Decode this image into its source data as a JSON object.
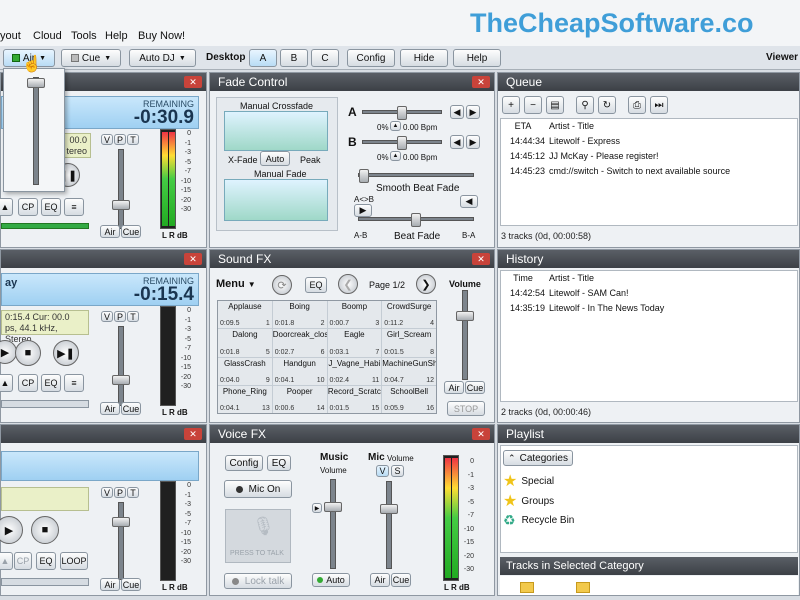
{
  "menubar": {
    "items": [
      "yout",
      "Cloud",
      "Tools",
      "Help",
      "Buy Now!"
    ],
    "watermark": "TheCheapSoftware.co"
  },
  "toolbar": {
    "air": "Air",
    "cue": "Cue",
    "auto_dj": "Auto DJ",
    "desktop_label": "Desktop",
    "desk_a": "A",
    "desk_b": "B",
    "desk_c": "C",
    "config": "Config",
    "hide": "Hide",
    "help": "Help",
    "viewer": "Viewer"
  },
  "decks": [
    {
      "remaining_label": "REMAINING",
      "remaining": "-0:30.9",
      "info_line1": "00.0",
      "info_line2": "tereo",
      "cp": "CP",
      "eq": "EQ"
    },
    {
      "title": "ay",
      "remaining_label": "REMAINING",
      "remaining": "-0:15.4",
      "info_line1": "0:15.4      Cur: 00.0",
      "info_line2": "ps, 44.1 kHz, Stereo",
      "cp": "CP",
      "eq": "EQ"
    },
    {
      "cp": "CP",
      "eq": "EQ",
      "loop": "LOOP"
    }
  ],
  "channel": {
    "v": "V",
    "p": "P",
    "t": "T",
    "air": "Air",
    "cue": "Cue",
    "lr": "L R",
    "db": "dB"
  },
  "meter_scale": [
    "0",
    "-1",
    "-3",
    "-5",
    "-7",
    "-10",
    "-15",
    "-20",
    "-30"
  ],
  "fade_control": {
    "title": "Fade Control",
    "manual_crossfade": "Manual Crossfade",
    "xfade": "X-Fade",
    "auto": "Auto",
    "peak": "Peak",
    "manual_fade": "Manual Fade",
    "a": "A",
    "b": "B",
    "pct_a": "0%",
    "bpm_a": "0.00 Bpm",
    "pct_b": "0%",
    "bpm_b": "0.00 Bpm",
    "smooth_beat_fade": "Smooth Beat Fade",
    "a_to_b": "A<>B",
    "a_b": "A-B",
    "beat_fade": "Beat Fade",
    "b_a": "B-A"
  },
  "sound_fx": {
    "title": "Sound FX",
    "menu": "Menu",
    "eq": "EQ",
    "page": "Page 1/2",
    "volume": "Volume",
    "air": "Air",
    "cue": "Cue",
    "stop": "STOP",
    "cells": [
      {
        "name": "Applause",
        "time": "0:09.5",
        "num": "1"
      },
      {
        "name": "Boing",
        "time": "0:01.8",
        "num": "2"
      },
      {
        "name": "Boomp",
        "time": "0:00.7",
        "num": "3"
      },
      {
        "name": "CrowdSurge",
        "time": "0:11.2",
        "num": "4"
      },
      {
        "name": "Dalong",
        "time": "0:01.8",
        "num": "5"
      },
      {
        "name": "Doorcreak_closi",
        "time": "0:02.7",
        "num": "6"
      },
      {
        "name": "Eagle",
        "time": "0:03.1",
        "num": "7"
      },
      {
        "name": "Girl_Scream",
        "time": "0:01.5",
        "num": "8"
      },
      {
        "name": "GlassCrash",
        "time": "0:04.0",
        "num": "9"
      },
      {
        "name": "Handgun",
        "time": "0:04.1",
        "num": "10"
      },
      {
        "name": "J_Vagne_Habi",
        "time": "0:02.4",
        "num": "11"
      },
      {
        "name": "MachineGunShe",
        "time": "0:04.7",
        "num": "12"
      },
      {
        "name": "Phone_Ring",
        "time": "0:04.1",
        "num": "13"
      },
      {
        "name": "Pooper",
        "time": "0:00.6",
        "num": "14"
      },
      {
        "name": "Record_Scratc",
        "time": "0:01.5",
        "num": "15"
      },
      {
        "name": "SchoolBell",
        "time": "0:05.9",
        "num": "16"
      }
    ]
  },
  "voice_fx": {
    "title": "Voice FX",
    "config": "Config",
    "eq": "EQ",
    "mic_on": "Mic On",
    "press_to_talk": "PRESS TO TALK",
    "lock_talk": "Lock talk",
    "music": "Music",
    "music_volume": "Volume",
    "mic": "Mic",
    "mic_volume": "Volume",
    "v": "V",
    "s": "S",
    "auto": "Auto",
    "air": "Air",
    "cue": "Cue",
    "lr": "L R",
    "db": "dB"
  },
  "queue": {
    "title": "Queue",
    "col_eta": "ETA",
    "col_title": "Artist - Title",
    "rows": [
      {
        "time": "14:44:34",
        "title": "Litewolf - Express"
      },
      {
        "time": "14:45:12",
        "title": "JJ McKay - Please register!"
      },
      {
        "time": "14:45:23",
        "title": "cmd://switch - Switch to next available source"
      }
    ],
    "status": "3 tracks (0d, 00:00:58)"
  },
  "history": {
    "title": "History",
    "col_time": "Time",
    "col_title": "Artist - Title",
    "rows": [
      {
        "time": "14:42:54",
        "title": "Litewolf - SAM Can!"
      },
      {
        "time": "14:35:19",
        "title": "Litewolf - In The News Today"
      }
    ],
    "status": "2 tracks (0d, 00:00:46)"
  },
  "playlist": {
    "title": "Playlist",
    "categories": "Categories",
    "items": [
      "Special",
      "Groups",
      "Recycle Bin"
    ],
    "tracks_header": "Tracks in Selected Category"
  },
  "air_dropdown_level": 0.8
}
